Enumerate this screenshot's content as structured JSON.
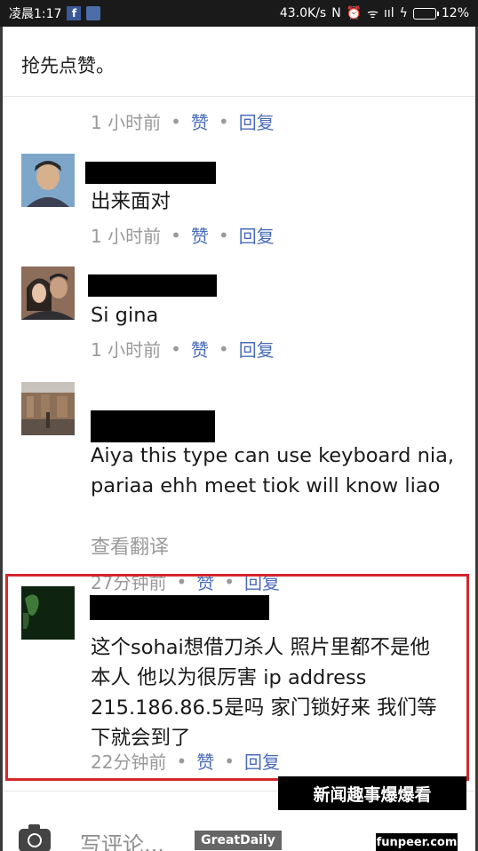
{
  "statusbar": {
    "time": "凌晨1:17",
    "fb": "f",
    "speed": "43.0K/s",
    "nfc": "N",
    "alarm": "⏰",
    "wifi": "ᯤ",
    "signal": "ııl",
    "bolt": "ϟ",
    "battery": "12%"
  },
  "header": {
    "title": "抢先点赞。"
  },
  "actions": {
    "like": "赞",
    "reply": "回复",
    "dot": "•"
  },
  "comments": [
    {
      "text": "",
      "time": "1 小时前"
    },
    {
      "text": "出来面对",
      "time": "1 小时前"
    },
    {
      "text": "Si gina",
      "time": "1 小时前"
    },
    {
      "text": "Aiya this type can use keyboard nia, pariaa ehh meet tiok will know liao",
      "translate": "查看翻译",
      "time": "27分钟前"
    },
    {
      "text": "这个sohai想借刀杀人 照片里都不是他本人 他以为很厉害 ip address 215.186.86.5是吗 家门锁好来 我们等下就会到了",
      "time": "22分钟前"
    }
  ],
  "footer": {
    "placeholder": "写评论..."
  },
  "watermarks": {
    "news": "新闻趣事爆爆看",
    "great_daily": "GreatDaily",
    "funpeer": "funpeer.com"
  },
  "colors": {
    "highlight_border": "#d5262c",
    "link": "#4a6cb8",
    "meta": "#9a9a9a"
  }
}
